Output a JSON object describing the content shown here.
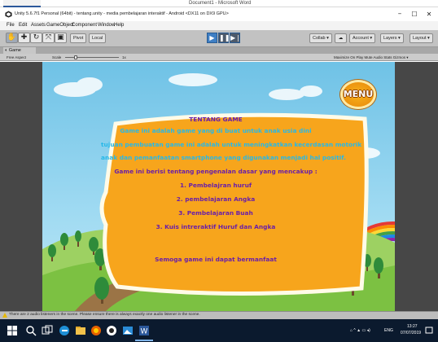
{
  "word_window": {
    "title": "Document1 - Microsoft Word"
  },
  "unity_window": {
    "title": "Unity 5.6.7f1 Personal (64bit) - tentang.unity - media pembelajaran interaktif - Android <DX11 on DX9 GPU>",
    "minimize": "–",
    "maximize": "☐",
    "close": "✕"
  },
  "menu": {
    "items": [
      "File",
      "Edit",
      "Assets",
      "GameObject",
      "Component",
      "Window",
      "Help"
    ]
  },
  "toolbar": {
    "pivot_label": "Pivot",
    "local_label": "Local",
    "collab_label": "Collab ▾",
    "cloud_icon": "cloud-icon",
    "account_label": "Account ▾",
    "layers_label": "Layers ▾",
    "layout_label": "Layout ▾"
  },
  "game_panel": {
    "tab_label": "Game",
    "aspect_label": "Free Aspect",
    "scale_label": "Scale",
    "scale_value": "1x",
    "options": "Maximize On Play  Mute Audio  Stats  Gizmos ▾"
  },
  "game": {
    "menu_button": "MENU",
    "panel": {
      "title": "TENTANG GAME",
      "line1": "Game ini adalah game yang di buat untuk anak usia dini",
      "line2": "tujuan pembuatan game ini adalah untuk meningkatkan kecerdasan motorik",
      "line3": "anak  dan pemanfaatan smartphone  yang digunakan menjadi hal positif.",
      "line4": "Game ini berisi tentang pengenalan dasar yang mencakup :",
      "list": [
        "1. Pembelajran huruf",
        "2. pembelajaran Angka",
        "3. Pembelajaran Buah",
        "3. Kuis intreraktif Huruf dan Angka"
      ],
      "closing": "Semoga game ini dapat bermanfaat"
    },
    "colors": {
      "panel_fill": "#f7a51c",
      "panel_border": "#fffbe8",
      "text_blue": "#27b8e8",
      "text_purple": "#6a1fa8"
    }
  },
  "console": {
    "message": "There are 2 audio listeners in the scene. Please ensure there is always exactly one audio listener in the scene."
  },
  "taskbar": {
    "icons": [
      "windows-start-icon",
      "search-icon",
      "task-view-icon",
      "edge-icon",
      "explorer-icon",
      "firefox-icon",
      "unity-icon",
      "photos-icon",
      "word-icon"
    ],
    "tray_text": "ENG",
    "time": "13:27",
    "date": "07/07/2019"
  }
}
